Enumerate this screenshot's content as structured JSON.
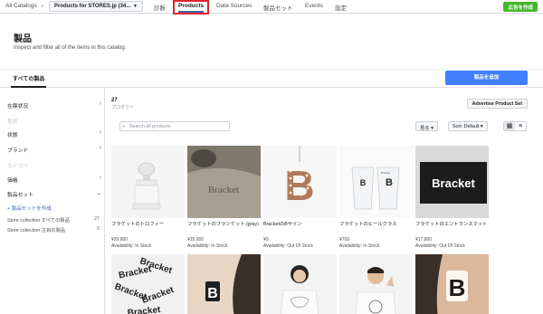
{
  "topbar": {
    "breadcrumb": "All Catalogs",
    "caret": "›",
    "catalog_select": "Products for STORES.jp (34...",
    "nav": [
      "診断",
      "Products",
      "Data Sources",
      "製品セット",
      "Events",
      "設定"
    ],
    "active_nav": "Products",
    "create_ad": "広告を作成"
  },
  "header": {
    "title": "製品",
    "subtitle": "Inspect and filter all of the items in this catalog."
  },
  "tabs": {
    "all_products": "すべての製品",
    "add_product": "製品を追加"
  },
  "sidebar": {
    "filters": [
      {
        "label": "在庫状況",
        "chevron": true,
        "dim": false
      },
      {
        "label": "性別",
        "chevron": false,
        "dim": true
      },
      {
        "label": "状態",
        "chevron": true,
        "dim": false
      },
      {
        "label": "ブランド",
        "chevron": true,
        "dim": false
      },
      {
        "label": "カテゴリ",
        "chevron": false,
        "dim": true
      },
      {
        "label": "価格",
        "chevron": true,
        "dim": false
      },
      {
        "label": "製品セット",
        "chevron": true,
        "dim": false
      }
    ],
    "create_set": "+ 製品セットを作成",
    "sets": [
      {
        "label": "Store collection すべての製品",
        "count": "27"
      },
      {
        "label": "Store collection 注目の製品",
        "count": "0"
      }
    ]
  },
  "main": {
    "count": "27",
    "count_label": "プロダクト",
    "advertise": "Advertise Product Set",
    "search_placeholder": "Search all products",
    "view_label": "見る ▾",
    "sort_label": "Sort: Default ▾",
    "products": [
      {
        "name": "ブラケットのトロフィー",
        "price": "¥39,800",
        "availability": "Availability: In Stock"
      },
      {
        "name": "ブラケットのブランケット (gray)",
        "price": "¥35,000",
        "availability": "Availability: In Stock"
      },
      {
        "name": "BracketのBサイン",
        "price": "¥0",
        "availability": "Availability: Out Of Stock"
      },
      {
        "name": "ブラケットのビールグラス",
        "price": "¥700",
        "availability": "Availability: In Stock"
      },
      {
        "name": "ブラケットのエントランスマット",
        "price": "¥17,800",
        "availability": "Availability: Out Of Stock"
      }
    ],
    "card_texts": {
      "blanket": "Bracket",
      "sign": "B",
      "glass_small": "Bracket",
      "glass_b": "B",
      "mat": "Bracket",
      "sticker": "Bracket",
      "earring": "B"
    }
  },
  "colors": {
    "primary": "#4080ff",
    "green": "#42b72a",
    "highlight": "#e0242a"
  }
}
